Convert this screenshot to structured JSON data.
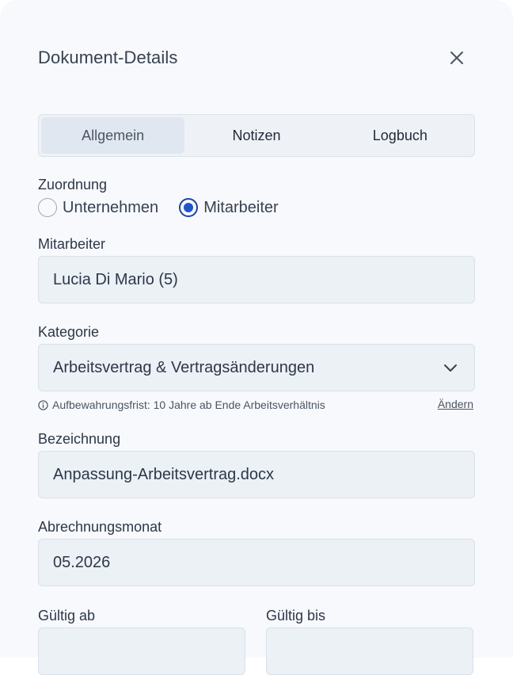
{
  "dialog": {
    "title": "Dokument-Details",
    "close_icon": "close-icon"
  },
  "tabs": [
    {
      "label": "Allgemein",
      "active": true
    },
    {
      "label": "Notizen",
      "active": false
    },
    {
      "label": "Logbuch",
      "active": false
    }
  ],
  "assignment": {
    "label": "Zuordnung",
    "options": [
      {
        "label": "Unternehmen",
        "checked": false
      },
      {
        "label": "Mitarbeiter",
        "checked": true
      }
    ]
  },
  "employee": {
    "label": "Mitarbeiter",
    "value": "Lucia Di Mario (5)"
  },
  "category": {
    "label": "Kategorie",
    "value": "Arbeitsvertrag & Vertragsänderungen",
    "hint": "Aufbewahrungsfrist: 10 Jahre ab Ende Arbeitsverhältnis",
    "hint_icon": "info-icon",
    "change_link": "Ändern"
  },
  "designation": {
    "label": "Bezeichnung",
    "value": "Anpassung-Arbeitsvertrag.docx"
  },
  "billing_month": {
    "label": "Abrechnungsmonat",
    "value": "05.2026"
  },
  "valid_from": {
    "label": "Gültig ab"
  },
  "valid_to": {
    "label": "Gültig bis"
  },
  "colors": {
    "panel_bg": "#f7f9fc",
    "field_bg": "#ecf1f6",
    "radio_accent": "#1e56c8"
  }
}
